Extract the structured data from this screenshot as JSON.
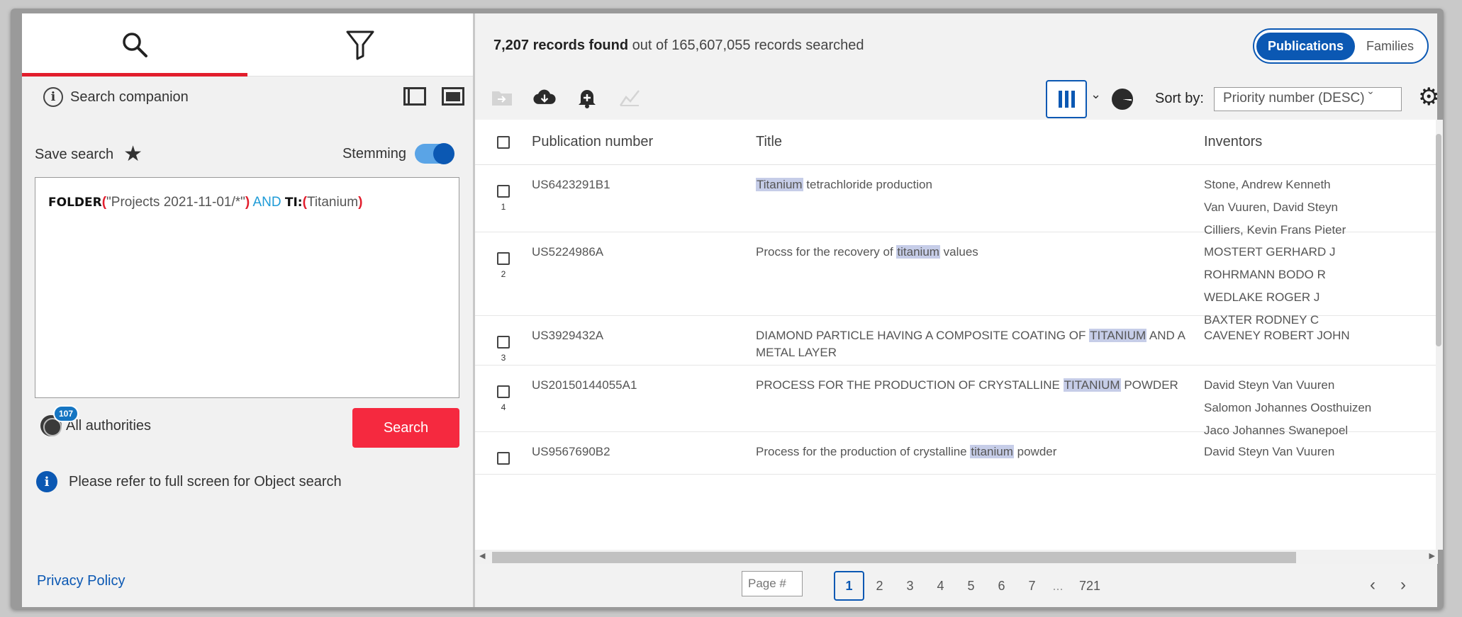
{
  "left": {
    "tabs": [
      {
        "name": "search",
        "icon": "search-icon",
        "active": true
      },
      {
        "name": "filter",
        "icon": "filter-icon",
        "active": false
      }
    ],
    "companion_label": "Search companion",
    "save_search_label": "Save search",
    "stemming_label": "Stemming",
    "stemming_on": true,
    "query": {
      "kw1": "FOLDER",
      "open1": "(",
      "str1": "\"Projects 2021-11-01/*\"",
      "close1": ")",
      "op": "AND",
      "kw2": "TI:",
      "open2": "(",
      "str2": "Titanium",
      "close2": ")"
    },
    "authorities_badge": "107",
    "authorities_label": "All authorities",
    "search_button": "Search",
    "notice": "Please refer to full screen for Object search",
    "privacy_link": "Privacy Policy"
  },
  "right": {
    "records_count": "7,207 records found",
    "records_rest": "out of 165,607,055 records searched",
    "view_toggle": {
      "publications": "Publications",
      "families": "Families",
      "active": "publications"
    },
    "sort_label": "Sort by:",
    "sort_value": "Priority number (DESC) ˇ",
    "columns": {
      "pub": "Publication number",
      "title": "Title",
      "inventors": "Inventors"
    },
    "rows": [
      {
        "num": "1",
        "pub": "US6423291B1",
        "title_pre": "",
        "title_hl": "Titanium",
        "title_post": " tetrachloride production",
        "inventors": [
          "Stone, Andrew Kenneth",
          "Van Vuuren, David Steyn",
          "Cilliers, Kevin Frans Pieter"
        ]
      },
      {
        "num": "2",
        "pub": "US5224986A",
        "title_pre": "Procss for the recovery of ",
        "title_hl": "titanium",
        "title_post": " values",
        "inventors": [
          "MOSTERT GERHARD J",
          "ROHRMANN BODO R",
          "WEDLAKE ROGER J",
          "BAXTER RODNEY C"
        ]
      },
      {
        "num": "3",
        "pub": "US3929432A",
        "title_pre": "DIAMOND PARTICLE HAVING A COMPOSITE COATING OF ",
        "title_hl": "TITANIUM",
        "title_post": " AND A METAL LAYER",
        "inventors": [
          "CAVENEY ROBERT JOHN"
        ]
      },
      {
        "num": "4",
        "pub": "US20150144055A1",
        "title_pre": "PROCESS FOR THE PRODUCTION OF CRYSTALLINE ",
        "title_hl": "TITANIUM",
        "title_post": " POWDER",
        "inventors": [
          "David Steyn Van Vuuren",
          "Salomon Johannes Oosthuizen",
          "Jaco Johannes Swanepoel"
        ]
      },
      {
        "num": "",
        "pub": "US9567690B2",
        "title_pre": "Process for the production of crystalline ",
        "title_hl": "titanium",
        "title_post": " powder",
        "inventors": [
          "David Steyn Van Vuuren"
        ]
      }
    ],
    "pager": {
      "placeholder": "Page #",
      "pages": [
        "1",
        "2",
        "3",
        "4",
        "5",
        "6",
        "7"
      ],
      "ellipsis": "...",
      "last": "721",
      "current": "1"
    }
  },
  "colors": {
    "accent": "#0b58b3",
    "search_button": "#f5293f",
    "tab_underline": "#e21e2d",
    "highlight": "#c6cde8"
  }
}
